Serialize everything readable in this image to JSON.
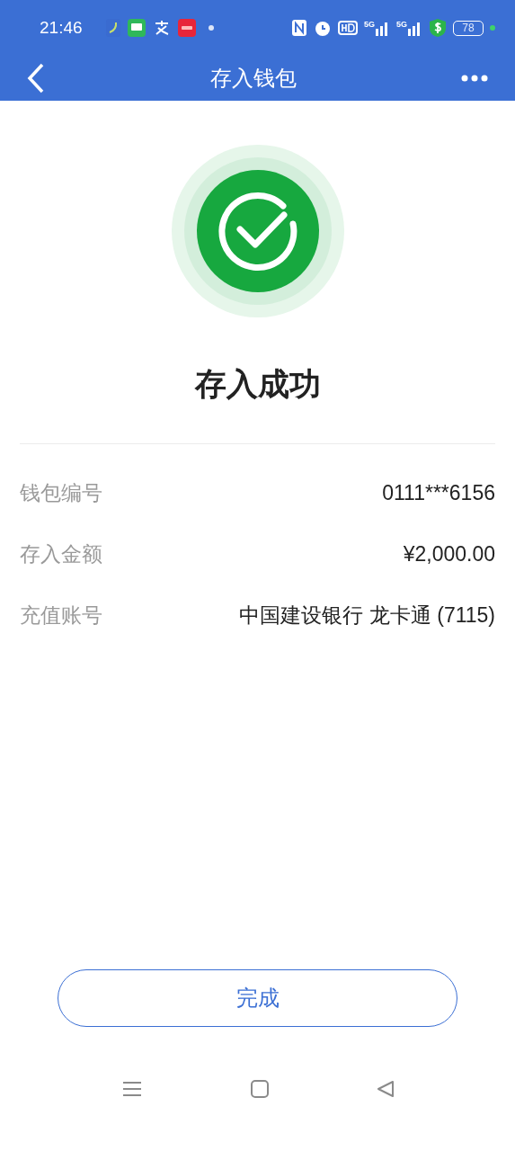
{
  "status_bar": {
    "time": "21:46",
    "network": [
      "5G",
      "5G"
    ],
    "battery": "78"
  },
  "nav": {
    "title": "存入钱包"
  },
  "result": {
    "title": "存入成功"
  },
  "details": [
    {
      "label": "钱包编号",
      "value": "0111***6156"
    },
    {
      "label": "存入金额",
      "value": "¥2,000.00"
    },
    {
      "label": "充值账号",
      "value": "中国建设银行 龙卡通 (7115)"
    }
  ],
  "done_button": "完成"
}
